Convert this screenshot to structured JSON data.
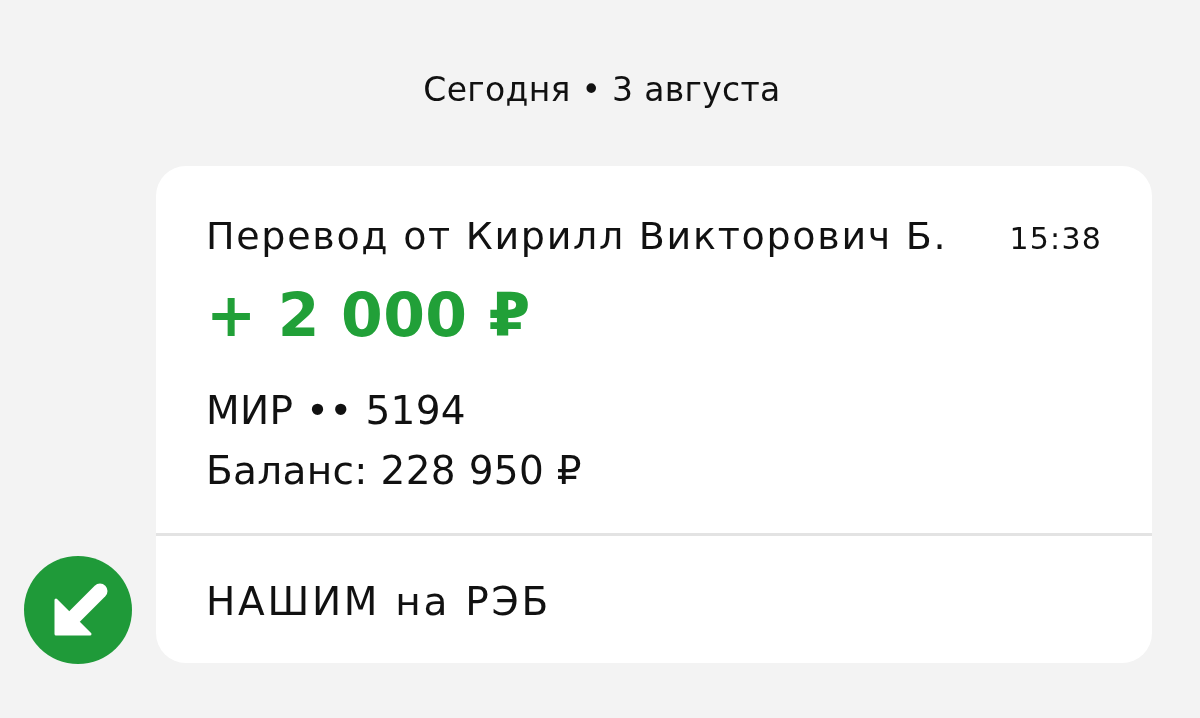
{
  "date_header": "Сегодня • 3 августа",
  "transaction": {
    "kind": "incoming",
    "title": "Перевод от Кирилл Викторович Б.",
    "time": "15:38",
    "amount": "+ 2 000 ₽",
    "card": "МИР •• 5194",
    "balance": "Баланс: 228 950 ₽",
    "message": "НАШИМ на РЭБ"
  }
}
